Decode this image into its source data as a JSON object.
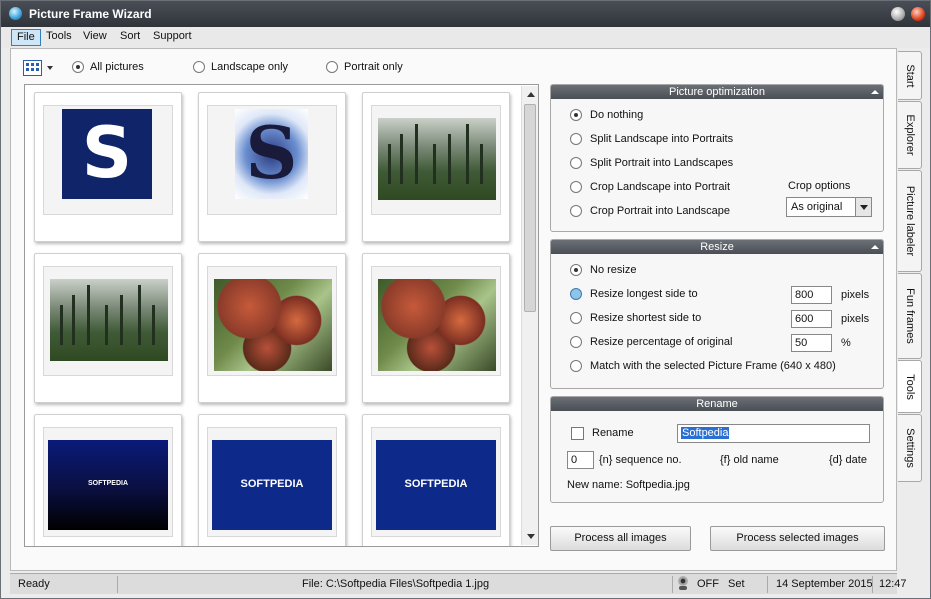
{
  "window": {
    "title": "Picture Frame Wizard"
  },
  "menu": [
    "File",
    "Tools",
    "View",
    "Sort",
    "Support"
  ],
  "filter": {
    "options": [
      "All pictures",
      "Landscape only",
      "Portrait only"
    ],
    "selected": "All pictures"
  },
  "thumbnails": [
    {
      "kind": "s-logo",
      "text": "S"
    },
    {
      "kind": "s-swirl",
      "text": "S"
    },
    {
      "kind": "forest"
    },
    {
      "kind": "forest"
    },
    {
      "kind": "leaves"
    },
    {
      "kind": "leaves"
    },
    {
      "kind": "softpedia-dark",
      "text": "SOFTPEDIA"
    },
    {
      "kind": "softpedia",
      "text": "SOFTPEDIA"
    },
    {
      "kind": "softpedia",
      "text": "SOFTPEDIA"
    }
  ],
  "optimization": {
    "title": "Picture optimization",
    "options": [
      "Do nothing",
      "Split Landscape into Portraits",
      "Split Portrait into Landscapes",
      "Crop Landscape into Portrait",
      "Crop Portrait into Landscape"
    ],
    "selected": "Do nothing",
    "crop_label": "Crop options",
    "crop_value": "As original"
  },
  "resize": {
    "title": "Resize",
    "no_resize": "No resize",
    "longest": {
      "label": "Resize longest side to",
      "value": "800",
      "unit": "pixels"
    },
    "shortest": {
      "label": "Resize shortest side to",
      "value": "600",
      "unit": "pixels"
    },
    "percentage": {
      "label": "Resize percentage of original",
      "value": "50",
      "unit": "%"
    },
    "match": "Match with the selected Picture Frame (640 x 480)",
    "selected": "No resize"
  },
  "rename": {
    "title": "Rename",
    "checkbox_label": "Rename",
    "name_value": "Softpedia",
    "seq_value": "0",
    "seq_label": "{n} sequence no.",
    "old_label": "{f} old name",
    "date_label": "{d} date",
    "new_name": "New name: Softpedia.jpg"
  },
  "buttons": {
    "process_all": "Process all images",
    "process_selected": "Process selected images"
  },
  "tabs": [
    "Start",
    "Explorer",
    "Picture labeler",
    "Fun frames",
    "Tools",
    "Settings"
  ],
  "status": {
    "state": "Ready",
    "file": "File: C:\\Softpedia Files\\Softpedia 1.jpg",
    "camera": "OFF",
    "set": "Set",
    "date": "14 September 2015",
    "time": "12:47"
  },
  "colors": {
    "panel_header": "#5a5e65",
    "selection": "#2b6fd3",
    "titlebar": "#3a3e45"
  },
  "icons": [
    "app-icon",
    "grid-view-icon",
    "camera-icon"
  ]
}
